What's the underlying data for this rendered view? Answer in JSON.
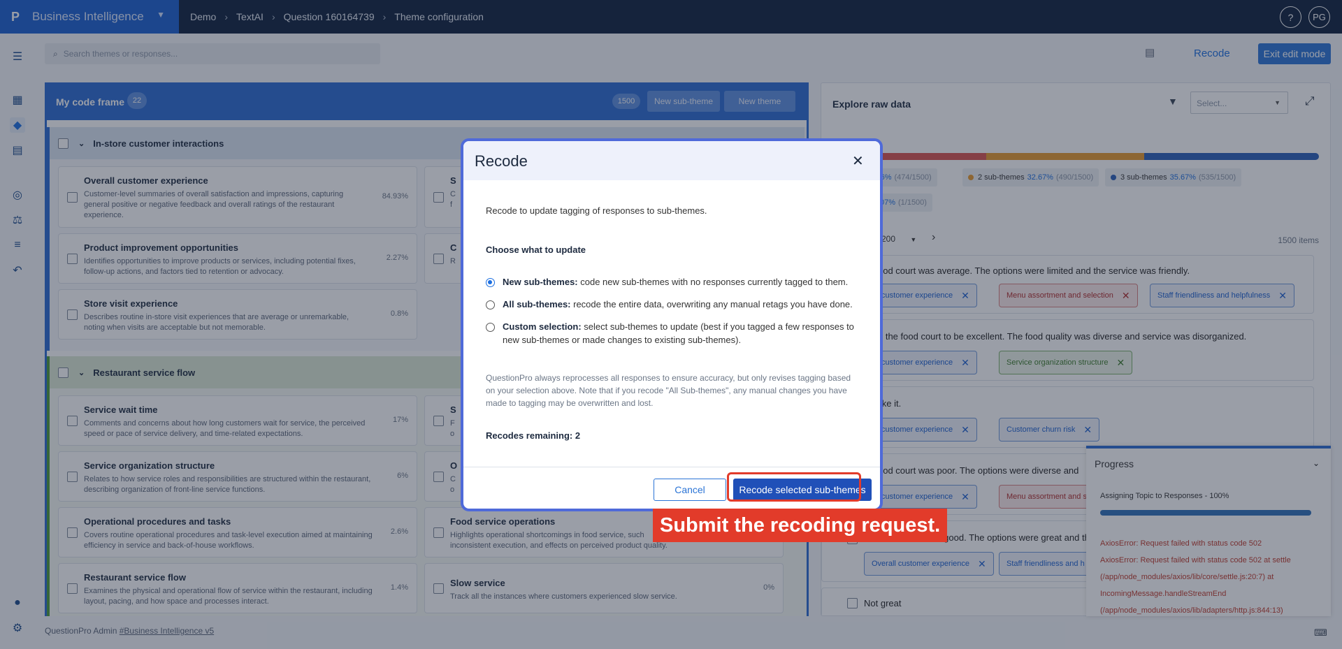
{
  "topbar": {
    "logo": "P",
    "app_name": "Business Intelligence",
    "breadcrumbs": [
      "Demo",
      "TextAI",
      "Question 160164739",
      "Theme configuration"
    ],
    "help_icon": "?",
    "avatar": "PG"
  },
  "toolbar": {
    "search_placeholder": "Search themes or responses...",
    "recode_label": "Recode",
    "exit_label": "Exit edit mode"
  },
  "code_frame": {
    "title": "My code frame",
    "count": "22",
    "total": "1500",
    "new_subtheme_label": "New sub-theme",
    "new_theme_label": "New theme",
    "groups": [
      {
        "name": "In-store customer interactions",
        "cards": [
          {
            "title": "Overall customer experience",
            "desc": "Customer-level summaries of overall satisfaction and impressions, capturing general positive or negative feedback and overall ratings of the restaurant experience.",
            "pct": "84.93%"
          },
          {
            "title": "Product improvement opportunities",
            "desc": "Identifies opportunities to improve products or services, including potential fixes, follow-up actions, and factors tied to retention or advocacy.",
            "pct": "2.27%"
          },
          {
            "title": "Store visit experience",
            "desc": "Describes routine in-store visit experiences that are average or unremarkable, noting when visits are acceptable but not memorable.",
            "pct": "0.8%"
          }
        ],
        "right_cards": [
          {
            "title": "S",
            "desc": "C\nf"
          },
          {
            "title": "C",
            "desc": "R"
          }
        ]
      },
      {
        "name": "Restaurant service flow",
        "cards": [
          {
            "title": "Service wait time",
            "desc": "Comments and concerns about how long customers wait for service, the perceived speed or pace of service delivery, and time-related expectations.",
            "pct": "17%"
          },
          {
            "title": "Service organization structure",
            "desc": "Relates to how service roles and responsibilities are structured within the restaurant, describing organization of front-line service functions.",
            "pct": "6%"
          },
          {
            "title": "Operational procedures and tasks",
            "desc": "Covers routine operational procedures and task-level execution aimed at maintaining efficiency in service and back-of-house workflows.",
            "pct": "2.6%"
          },
          {
            "title": "Restaurant service flow",
            "desc": "Examines the physical and operational flow of service within the restaurant, including layout, pacing, and how space and processes interact.",
            "pct": "1.4%"
          }
        ],
        "right_cards": [
          {
            "title": "S",
            "desc": "F\no"
          },
          {
            "title": "O",
            "desc": "C\no"
          },
          {
            "title": "Food service operations",
            "desc": "Highlights operational shortcomings in food service, such\ninconsistent execution, and effects on perceived product quality."
          },
          {
            "title": "Slow service",
            "desc": "Track all the instances where customers experienced slow service.",
            "pct": "0%"
          }
        ]
      }
    ]
  },
  "explore": {
    "title": "Explore raw data",
    "select_placeholder": "Select...",
    "coverage_label": "erage",
    "legend": [
      {
        "label": "me",
        "pct": "31.6%",
        "count": "(474/1500)",
        "color": "#d9534f"
      },
      {
        "label": "2 sub-themes",
        "pct": "32.67%",
        "count": "(490/1500)",
        "color": "#e89a2c"
      },
      {
        "label": "3 sub-themes",
        "pct": "35.67%",
        "count": "(535/1500)",
        "color": "#2b5fb8"
      },
      {
        "label": "mes",
        "pct": "0.07%",
        "count": "(1/1500)",
        "color": "#2b5fb8"
      }
    ],
    "page_size": "200",
    "items_count": "1500 items",
    "responses": [
      {
        "text": "ood court was average. The options were limited and the service was friendly.",
        "chips": [
          {
            "label": "all customer experience",
            "tone": "blue"
          },
          {
            "label": "Menu assortment and selection",
            "tone": "red"
          },
          {
            "label": "Staff friendliness and helpfulness",
            "tone": "blue"
          }
        ]
      },
      {
        "text": "d the food court to be excellent. The food quality was diverse and service was disorganized.",
        "chips": [
          {
            "label": "all customer experience",
            "tone": "blue"
          },
          {
            "label": "Service organization structure",
            "tone": "green"
          }
        ]
      },
      {
        "text": "like it.",
        "chips": [
          {
            "label": "all customer experience",
            "tone": "blue"
          },
          {
            "label": "Customer churn risk",
            "tone": "blue"
          }
        ]
      },
      {
        "text": "ood court was poor. The options were diverse and",
        "chips": [
          {
            "label": "all customer experience",
            "tone": "blue"
          },
          {
            "label": "Menu assortment and s",
            "tone": "red"
          }
        ]
      },
      {
        "text": "The food court was good. The options were great and th",
        "chips": [
          {
            "label": "Overall customer experience",
            "tone": "blue"
          },
          {
            "label": "Staff friendliness and h",
            "tone": "blue"
          }
        ]
      },
      {
        "text": "Not great",
        "chips": []
      }
    ]
  },
  "progress": {
    "title": "Progress",
    "task": "Assigning Topic to Responses - 100%",
    "progress_fraction": 1.0,
    "errors": [
      "AxiosError: Request failed with status code 502",
      "AxiosError: Request failed with status code 502 at settle",
      "(/app/node_modules/axios/lib/core/settle.js:20:7) at",
      "IncomingMessage.handleStreamEnd",
      "(/app/node_modules/axios/lib/adapters/http.js:844:13)"
    ]
  },
  "modal": {
    "title": "Recode",
    "intro": "Recode to update tagging of responses to sub-themes.",
    "choose_label": "Choose what to update",
    "options": [
      {
        "bold": "New sub-themes:",
        "text": " code new sub-themes with no responses currently tagged to them."
      },
      {
        "bold": "All sub-themes:",
        "text": " recode the entire data, overwriting any manual retags you have done."
      },
      {
        "bold": "Custom selection:",
        "text": " select sub-themes to update (best if you tagged a few responses to new sub-themes or made changes to existing sub-themes)."
      }
    ],
    "note": "QuestionPro always reprocesses all responses to ensure accuracy, but only revises tagging based on your selection above. Note that if you recode \"All Sub-themes\", any manual changes you have made to tagging may be overwritten and lost.",
    "remaining": "Recodes remaining: 2",
    "cancel_label": "Cancel",
    "submit_label": "Recode selected sub-themes"
  },
  "annotation": {
    "callout": "Submit the recoding request."
  },
  "footer": {
    "prefix": "QuestionPro Admin ",
    "link": "#Business Intelligence v5"
  },
  "colors": {
    "brand": "#1b5fcf",
    "topbar": "#0d1f3c",
    "highlight": "#e23b2a"
  }
}
